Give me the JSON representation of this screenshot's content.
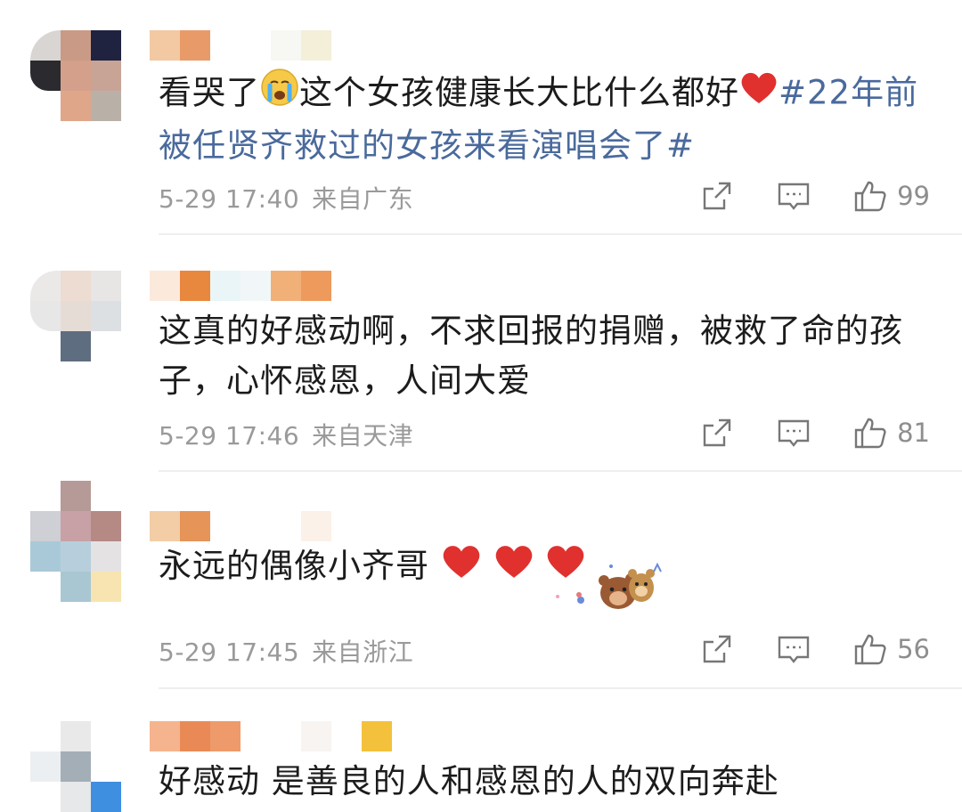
{
  "comments": [
    {
      "text_parts": [
        "看哭了",
        "这个女孩健康长大比什么都好",
        "#22年前被任贤齐救过的女孩来看演唱会了#"
      ],
      "date": "5-29 17:40",
      "location": "来自广东",
      "likes": "99"
    },
    {
      "text": "这真的好感动啊，不求回报的捐赠，被救了命的孩子，心怀感恩，人间大爱",
      "date": "5-29 17:46",
      "location": "来自天津",
      "likes": "81"
    },
    {
      "text": "永远的偶像小齐哥",
      "date": "5-29 17:45",
      "location": "来自浙江",
      "likes": "56"
    },
    {
      "text": "好感动 是善良的人和感恩的人的双向奔赴"
    }
  ],
  "icons": {
    "share": "share-icon",
    "comment": "comment-icon",
    "like": "thumbs-up-icon",
    "crying": "crying-face-emoji",
    "heart": "red-heart-emoji",
    "sticker": "bear-sticker"
  },
  "colors": {
    "topic": "#4a6a9c",
    "meta": "#9a9a9a",
    "heart": "#e0312f"
  }
}
